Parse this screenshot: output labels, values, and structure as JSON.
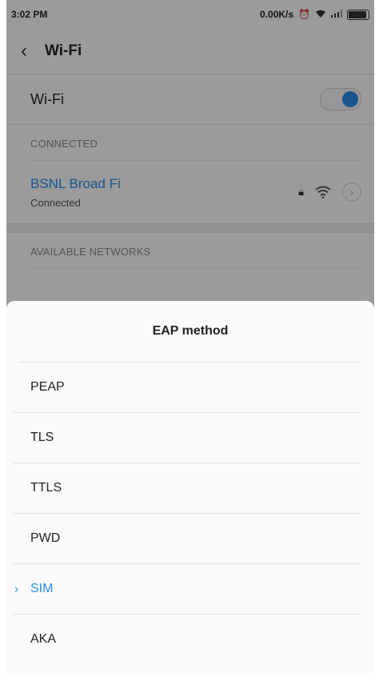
{
  "status_bar": {
    "time": "3:02 PM",
    "speed": "0.00K/s"
  },
  "header": {
    "title": "Wi-Fi",
    "back_icon": "chevron-left-icon"
  },
  "wifi_toggle": {
    "label": "Wi-Fi",
    "on": true,
    "accent": "#2a8ce6"
  },
  "connected_section": {
    "header": "CONNECTED",
    "network": {
      "name": "BSNL Broad Fi",
      "status": "Connected"
    }
  },
  "available_section": {
    "header": "AVAILABLE NETWORKS"
  },
  "dialog": {
    "title": "EAP method",
    "options": [
      {
        "label": "PEAP",
        "selected": false
      },
      {
        "label": "TLS",
        "selected": false
      },
      {
        "label": "TTLS",
        "selected": false
      },
      {
        "label": "PWD",
        "selected": false
      },
      {
        "label": "SIM",
        "selected": true
      },
      {
        "label": "AKA",
        "selected": false
      }
    ]
  }
}
